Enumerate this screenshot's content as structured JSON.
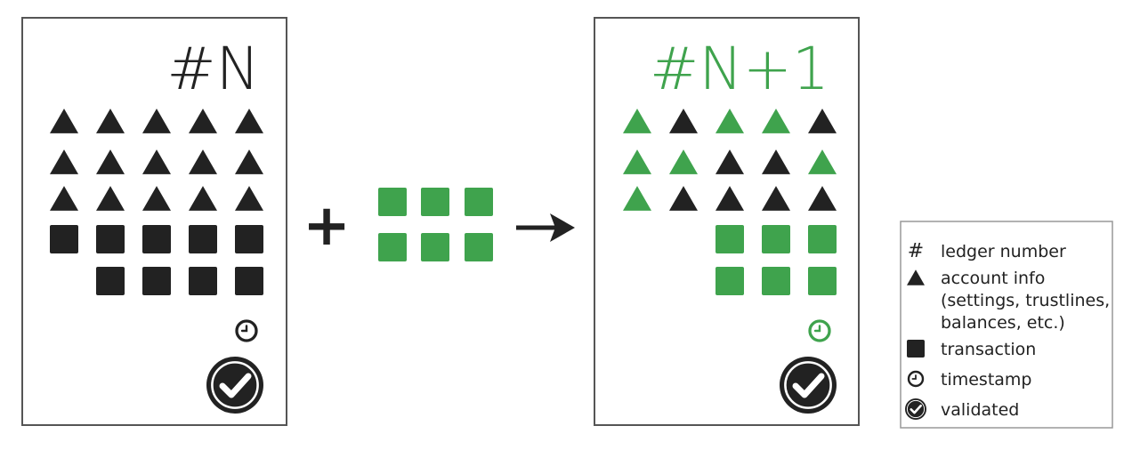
{
  "colors": {
    "dark": "#222222",
    "green": "#3fa34d",
    "border": "#555555",
    "legend_border": "#999999"
  },
  "ledger_before": {
    "title": "#N",
    "triangle_rows": [
      [
        "dark",
        "dark",
        "dark",
        "dark",
        "dark"
      ],
      [
        "dark",
        "dark",
        "dark",
        "dark",
        "dark"
      ],
      [
        "dark",
        "dark",
        "dark",
        "dark",
        "dark"
      ]
    ],
    "square_rows": [
      [
        "dark",
        "dark",
        "dark",
        "dark",
        "dark"
      ],
      [
        "none",
        "dark",
        "dark",
        "dark",
        "dark"
      ]
    ],
    "timestamp_color": "dark",
    "validated_color": "dark"
  },
  "operator_plus": "+",
  "incoming_transactions": [
    [
      "green",
      "green",
      "green"
    ],
    [
      "green",
      "green",
      "green"
    ]
  ],
  "operator_arrow": "arrow-right-icon",
  "ledger_after": {
    "title": "#N+1",
    "triangle_rows": [
      [
        "green",
        "dark",
        "green",
        "green",
        "dark"
      ],
      [
        "green",
        "green",
        "dark",
        "dark",
        "green"
      ],
      [
        "green",
        "dark",
        "dark",
        "dark",
        "dark"
      ]
    ],
    "square_rows": [
      [
        "none",
        "none",
        "green",
        "green",
        "green"
      ],
      [
        "none",
        "none",
        "green",
        "green",
        "green"
      ]
    ],
    "timestamp_color": "green",
    "validated_color": "dark"
  },
  "legend": {
    "items": [
      {
        "icon": "hash-icon",
        "symbol": "#",
        "lines": [
          "ledger number"
        ]
      },
      {
        "icon": "triangle-icon",
        "lines": [
          "account info",
          "(settings, trustlines,",
          "balances, etc.)"
        ]
      },
      {
        "icon": "square-icon",
        "lines": [
          "transaction"
        ]
      },
      {
        "icon": "clock-icon",
        "lines": [
          "timestamp"
        ]
      },
      {
        "icon": "check-circle-icon",
        "lines": [
          "validated"
        ]
      }
    ]
  }
}
